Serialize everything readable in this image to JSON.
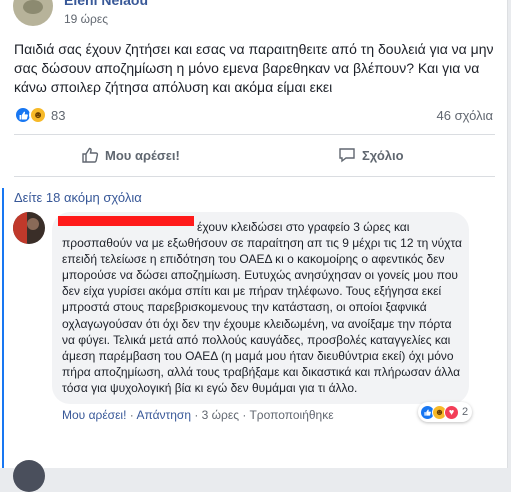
{
  "post": {
    "author": "Eleni Nelaou",
    "time": "19 ώρες",
    "text": "Παιδιά σας έχουν ζητήσει και εσας να παραιτηθειτε από τη δουλειά για να μην σας δώσουν αποζημίωση η μόνο εμενα βαρεθηκαν να βλέπουν? Και για να κάνω σποιλερ ζήτησα απόλυση και ακόμα είμαι εκει",
    "reaction_count": "83",
    "comment_count": "46 σχόλια"
  },
  "actions": {
    "like_label": "Μου αρέσει!",
    "comment_label": "Σχόλιο"
  },
  "comments_link": "Δείτε 18 ακόμη σχόλια",
  "comment": {
    "text": "έχουν κλειδώσει στο γραφείο 3 ώρες και προσπαθούν να με εξωθήσουν σε παραίτηση απ τις 9 μέχρι τις 12 τη νύχτα επειδή τελείωσε η επιδότηση του ΟΑΕΔ κι ο κακομοίρης ο αφεντικός δεν μπορούσε να δώσει αποζημίωση. Ευτυχώς ανησύχησαν οι γονείς μου που δεν είχα γυρίσει ακόμα σπίτι και με πήραν τηλέφωνο. Τους εξήγησα εκεί μπροστά στους παρεβρισκομενους την κατάσταση, οι οποίοι ξαφνικά οχλαγωγούσαν ότι όχι δεν την έχουμε κλειδωμένη, να ανοίξαμε την πόρτα να φύγει. Τελικά μετά από πολλούς καυγάδες, προσβολές καταγγελίες και άμεση παρέμβαση του ΟΑΕΔ (η μαμά μου ήταν διευθύντρια εκεί) όχι μόνο πήρα αποζημίωση, αλλά τους τραβήξαμε και δικαστικά και πλήρωσαν άλλα τόσα για ψυχολογική βία κι εγώ δεν θυμάμαι για τι άλλο.",
    "like": "Μου αρέσει!",
    "dot1": " · ",
    "reply": "Απάντηση",
    "dot2": " · ",
    "time": "3 ώρες",
    "dot3": " · ",
    "edited": "Τροποποιήθηκε",
    "reaction_count": "2"
  },
  "icons": [
    "like-icon",
    "haha-icon",
    "love-icon",
    "thumbs-up-icon",
    "speech-bubble-icon"
  ],
  "colors": {
    "link": "#385898",
    "like": "#1877f2",
    "haha": "#f7b928",
    "love": "#f33e58",
    "redaction": "#ff1a1a"
  }
}
